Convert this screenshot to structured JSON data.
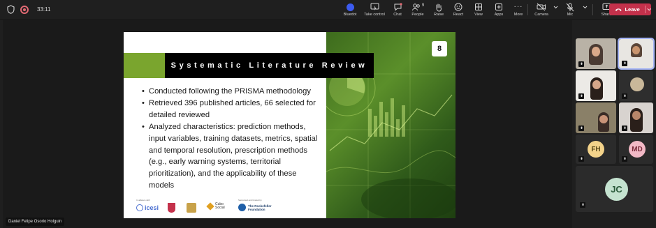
{
  "meeting": {
    "timer": "33:11"
  },
  "toolbar": {
    "items": [
      {
        "id": "bluedot",
        "label": "Bluedot"
      },
      {
        "id": "take-control",
        "label": "Take control"
      },
      {
        "id": "chat",
        "label": "Chat"
      },
      {
        "id": "people",
        "label": "People",
        "count": "9"
      },
      {
        "id": "raise",
        "label": "Raise"
      },
      {
        "id": "react",
        "label": "React"
      },
      {
        "id": "view",
        "label": "View"
      },
      {
        "id": "apps",
        "label": "Apps"
      },
      {
        "id": "more",
        "label": "More"
      },
      {
        "id": "camera",
        "label": "Camera"
      },
      {
        "id": "mic",
        "label": "Mic"
      },
      {
        "id": "share",
        "label": "Share"
      }
    ],
    "leave_label": "Leave"
  },
  "slide": {
    "number": "8",
    "title": "Systematic Literature Review",
    "bullets": [
      "Conducted following the PRISMA methodology",
      "Retrieved 396 published articles, 66  selected for detailed reviewed",
      "Analyzed characteristics: prediction methods, input variables, training datasets, metrics, spatial and temporal resolution, prescription methods (e.g., early warning systems, territorial prioritization), and the applicability of these models"
    ],
    "logos": {
      "caption_left": "In alliance with",
      "icesi": "icesi",
      "cubo": "Cubo Social",
      "caption_right": "Supported and funded by",
      "rockefeller": "The Rockefeller Foundation"
    }
  },
  "presenter": {
    "name": "Daniel Felipe Osorio Holguin"
  },
  "participants": [
    {
      "type": "video",
      "name": "participant-1"
    },
    {
      "type": "video",
      "name": "participant-2",
      "active": true
    },
    {
      "type": "video",
      "name": "participant-3"
    },
    {
      "type": "video",
      "name": "participant-4"
    },
    {
      "type": "video",
      "name": "participant-5"
    },
    {
      "type": "video",
      "name": "participant-6"
    },
    {
      "type": "initials",
      "initials": "FH",
      "color": "#f3d38a"
    },
    {
      "type": "initials",
      "initials": "MD",
      "color": "#f2b9c6"
    },
    {
      "type": "initials",
      "initials": "JC",
      "color": "#c5e3d0"
    }
  ],
  "colors": {
    "background": "#1f1f1f",
    "leave": "#c4314b",
    "bluedot": "#3c5bf0",
    "slide_green": "#7aa52e"
  }
}
